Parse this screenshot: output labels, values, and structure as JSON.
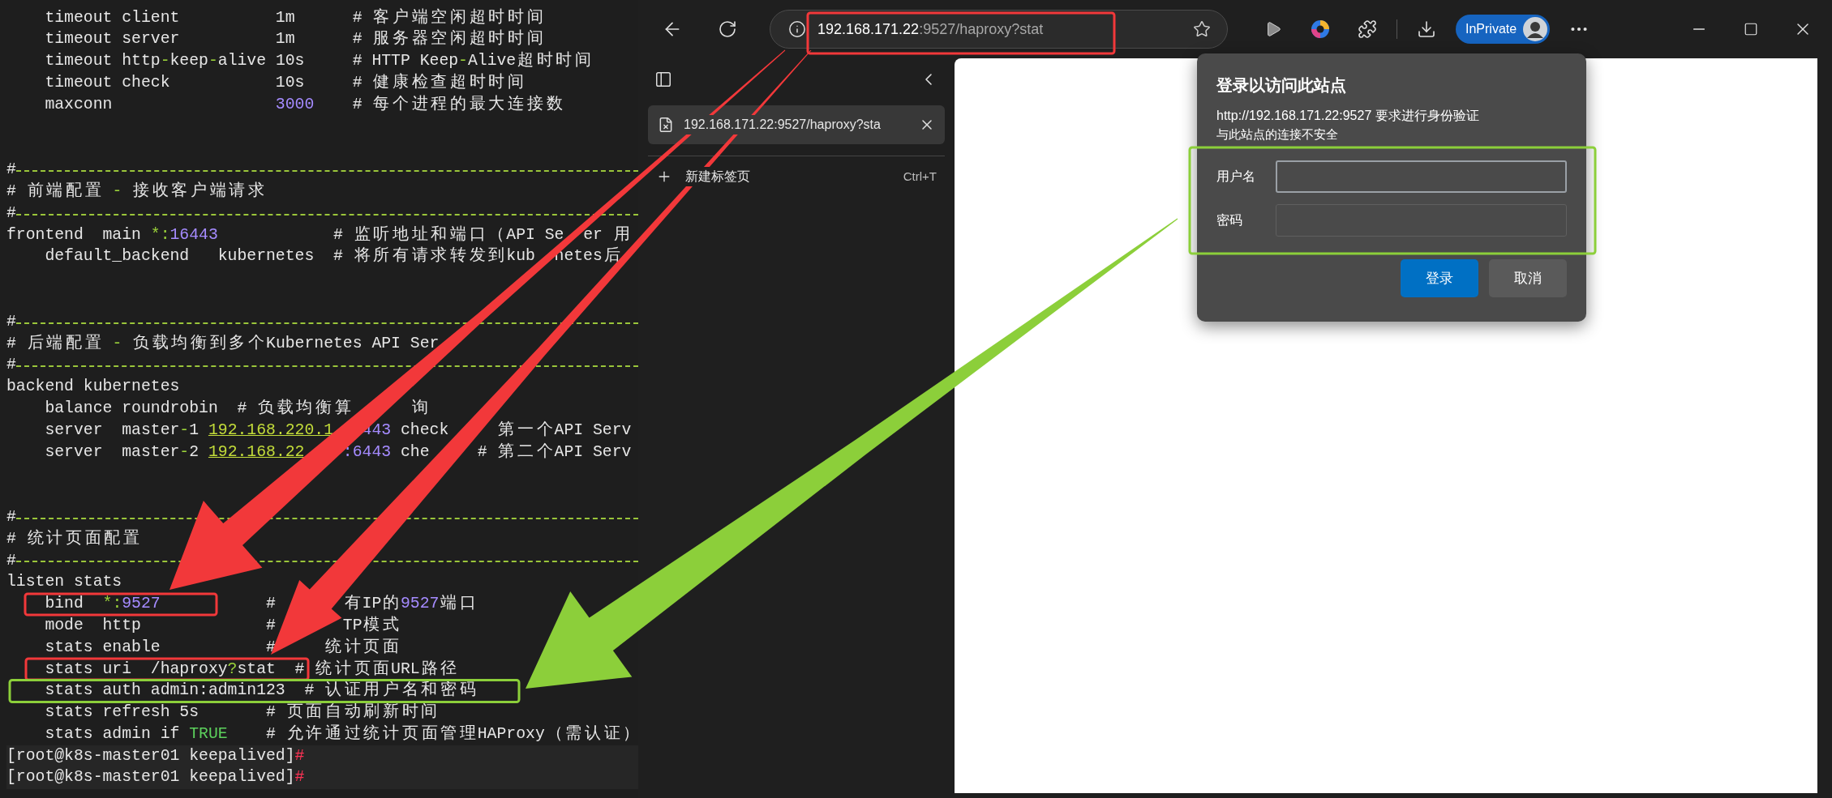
{
  "terminal": {
    "lines": [
      {
        "kind": "code",
        "segments": [
          {
            "kind": "plain",
            "text": "    timeout client          1m      # 客户端空闲超时时间"
          }
        ]
      },
      {
        "kind": "code",
        "segments": [
          {
            "kind": "plain",
            "text": "    timeout server          1m      # 服务器空闲超时时间"
          }
        ]
      },
      {
        "kind": "code",
        "segments": [
          {
            "kind": "plain",
            "text": "    timeout http"
          },
          {
            "kind": "symbol",
            "text": "-"
          },
          {
            "kind": "plain",
            "text": "keep"
          },
          {
            "kind": "symbol",
            "text": "-"
          },
          {
            "kind": "plain",
            "text": "alive 10s     # HTTP Keep"
          },
          {
            "kind": "symbol",
            "text": "-"
          },
          {
            "kind": "plain",
            "text": "Alive超时时间"
          }
        ]
      },
      {
        "kind": "code",
        "segments": [
          {
            "kind": "plain",
            "text": "    timeout check           10s     # 健康检查超时时间"
          }
        ]
      },
      {
        "kind": "code",
        "segments": [
          {
            "kind": "plain",
            "text": "    maxconn                 "
          },
          {
            "kind": "number",
            "text": "3000"
          },
          {
            "kind": "plain",
            "text": "    # 每个进程的最大连接数"
          }
        ]
      },
      {
        "kind": "blank"
      },
      {
        "kind": "blank"
      },
      {
        "kind": "rule",
        "text": "#"
      },
      {
        "kind": "code",
        "segments": [
          {
            "kind": "plain",
            "text": "# 前端配置 "
          },
          {
            "kind": "symbol",
            "text": "-"
          },
          {
            "kind": "plain",
            "text": " 接收客户端请求"
          }
        ]
      },
      {
        "kind": "rule",
        "text": "#"
      },
      {
        "kind": "code",
        "segments": [
          {
            "kind": "plain",
            "text": "frontend  main "
          },
          {
            "kind": "symbol",
            "text": "*:"
          },
          {
            "kind": "number",
            "text": "16443"
          },
          {
            "kind": "plain",
            "text": "            # 监听地址和端口（API Se  er 用"
          }
        ]
      },
      {
        "kind": "code",
        "segments": [
          {
            "kind": "plain",
            "text": "    default_backend   kubernetes  # 将所有请求转发到kub  netes后"
          }
        ]
      },
      {
        "kind": "blank"
      },
      {
        "kind": "blank"
      },
      {
        "kind": "rule",
        "text": "#"
      },
      {
        "kind": "code",
        "segments": [
          {
            "kind": "plain",
            "text": "# 后端配置 "
          },
          {
            "kind": "symbol",
            "text": "-"
          },
          {
            "kind": "plain",
            "text": " 负载均衡到多个Kubernetes API Ser"
          }
        ]
      },
      {
        "kind": "rule",
        "text": "#"
      },
      {
        "kind": "code",
        "segments": [
          {
            "kind": "plain",
            "text": "backend kubernetes"
          }
        ]
      },
      {
        "kind": "code",
        "segments": [
          {
            "kind": "plain",
            "text": "    balance roundrobin  # 负载均衡算      询"
          }
        ]
      },
      {
        "kind": "code",
        "segments": [
          {
            "kind": "plain",
            "text": "    server  master"
          },
          {
            "kind": "symbol",
            "text": "-"
          },
          {
            "kind": "plain",
            "text": "1 "
          },
          {
            "kind": "ip",
            "text": "192.168.220.1"
          },
          {
            "kind": "number",
            "text": "   443"
          },
          {
            "kind": "plain",
            "text": " check     第一个API Serv"
          }
        ]
      },
      {
        "kind": "code",
        "segments": [
          {
            "kind": "plain",
            "text": "    server  master"
          },
          {
            "kind": "symbol",
            "text": "-"
          },
          {
            "kind": "plain",
            "text": "2 "
          },
          {
            "kind": "ip",
            "text": "192.168.22"
          },
          {
            "kind": "number",
            "text": "    :6443"
          },
          {
            "kind": "plain",
            "text": " che     # 第二个API Serv"
          }
        ]
      },
      {
        "kind": "blank"
      },
      {
        "kind": "blank"
      },
      {
        "kind": "rule",
        "text": "#"
      },
      {
        "kind": "code",
        "segments": [
          {
            "kind": "plain",
            "text": "# 统计页面配置"
          }
        ]
      },
      {
        "kind": "rule",
        "text": "#"
      },
      {
        "kind": "code",
        "segments": [
          {
            "kind": "plain",
            "text": "listen stats"
          }
        ]
      },
      {
        "kind": "code",
        "segments": [
          {
            "kind": "plain",
            "text": "    bind  "
          },
          {
            "kind": "symbol",
            "text": "*:"
          },
          {
            "kind": "number",
            "text": "9527"
          },
          {
            "kind": "plain",
            "text": "           #       有IP的"
          },
          {
            "kind": "number",
            "text": "9527"
          },
          {
            "kind": "plain",
            "text": "端口"
          }
        ]
      },
      {
        "kind": "code",
        "segments": [
          {
            "kind": "plain",
            "text": "    mode  http             #       TP模式"
          }
        ]
      },
      {
        "kind": "code",
        "segments": [
          {
            "kind": "plain",
            "text": "    stats enable           #     统计页面"
          }
        ]
      },
      {
        "kind": "code",
        "segments": [
          {
            "kind": "plain",
            "text": "    stats uri  /haproxy"
          },
          {
            "kind": "symbol",
            "text": "?"
          },
          {
            "kind": "plain",
            "text": "stat  # 统计页面URL路径"
          }
        ]
      },
      {
        "kind": "code",
        "segments": [
          {
            "kind": "plain",
            "text": "    stats auth admin:admin123  # 认证用户名和密码"
          }
        ]
      },
      {
        "kind": "code",
        "segments": [
          {
            "kind": "plain",
            "text": "    stats refresh 5s       # 页面自动刷新时间"
          }
        ]
      },
      {
        "kind": "code",
        "segments": [
          {
            "kind": "plain",
            "text": "    stats admin if "
          },
          {
            "kind": "bool",
            "text": "TRUE"
          },
          {
            "kind": "plain",
            "text": "    # 允许通过统计页面管理HAProxy（需认证）"
          }
        ]
      },
      {
        "kind": "prompt",
        "segments": [
          {
            "kind": "plain",
            "text": "[root@k8s-master01 keepalived]"
          },
          {
            "kind": "mark",
            "text": "#"
          }
        ]
      },
      {
        "kind": "prompt",
        "segments": [
          {
            "kind": "plain",
            "text": "[root@k8s-master01 keepalived]"
          },
          {
            "kind": "mark",
            "text": "#"
          }
        ]
      }
    ]
  },
  "browser": {
    "address": {
      "host": "192.168.171.22",
      "path": ":9527/haproxy?stat"
    },
    "profile_badge": "InPrivate",
    "sidebar": {
      "tabs": [
        {
          "title": "192.168.171.22:9527/haproxy?sta",
          "selected": true
        }
      ],
      "new_tab": {
        "label": "新建标签页",
        "shortcut": "Ctrl+T"
      }
    },
    "dialog": {
      "title": "登录以访问此站点",
      "message": "http://192.168.171.22:9527 要求进行身份验证",
      "warning": "与此站点的连接不安全",
      "fields": [
        {
          "label": "用户名",
          "focused": true
        },
        {
          "label": "密码",
          "focused": false
        }
      ],
      "buttons": [
        {
          "label": "登录",
          "kind": "primary"
        },
        {
          "label": "取消",
          "kind": "secondary"
        }
      ]
    }
  },
  "annotations": [
    {
      "kind": "frame",
      "color": "#f2383a"
    },
    {
      "kind": "frame",
      "color": "#f2383a"
    },
    {
      "kind": "frame",
      "color": "#f2383a"
    },
    {
      "kind": "frame",
      "color": "#8ccf3a"
    },
    {
      "kind": "frame",
      "color": "#8ccf3a"
    },
    {
      "kind": "arrow",
      "color": "#f2383a"
    },
    {
      "kind": "arrow",
      "color": "#f2383a"
    },
    {
      "kind": "arrow",
      "color": "#8ccf3a"
    }
  ]
}
